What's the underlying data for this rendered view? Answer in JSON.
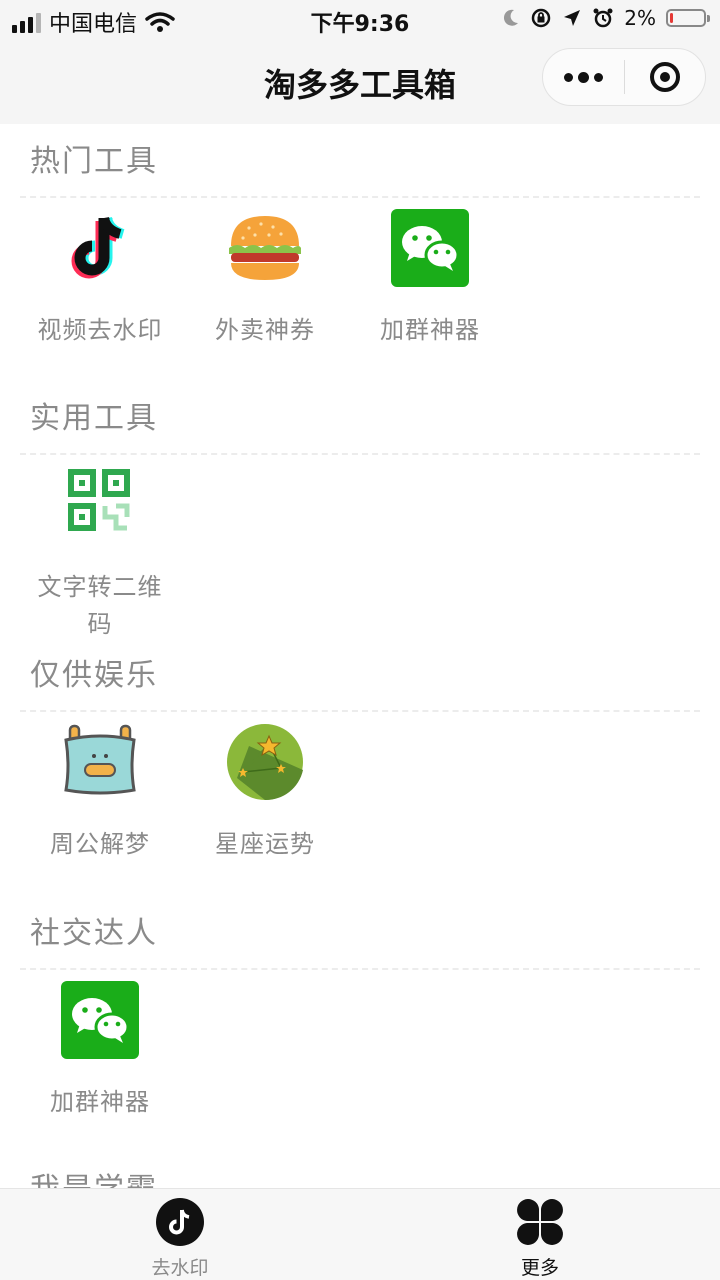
{
  "status_bar": {
    "carrier": "中国电信",
    "time": "下午9:36",
    "battery_percent": "2%",
    "battery_level": 0.02
  },
  "nav": {
    "title": "淘多多工具箱"
  },
  "sections": [
    {
      "title": "热门工具",
      "tools": [
        {
          "label": "视频去水印",
          "icon": "douyin-icon"
        },
        {
          "label": "外卖神券",
          "icon": "burger-icon"
        },
        {
          "label": "加群神器",
          "icon": "wechat-icon"
        }
      ]
    },
    {
      "title": "实用工具",
      "tools": [
        {
          "label": "文字转二维码",
          "icon": "qrcode-icon"
        }
      ]
    },
    {
      "title": "仅供娱乐",
      "tools": [
        {
          "label": "周公解梦",
          "icon": "pillow-icon"
        },
        {
          "label": "星座运势",
          "icon": "constellation-icon"
        }
      ]
    },
    {
      "title": "社交达人",
      "tools": [
        {
          "label": "加群神器",
          "icon": "wechat-icon"
        }
      ]
    },
    {
      "title": "我是学霸",
      "tools": []
    }
  ],
  "tabbar": {
    "tabs": [
      {
        "label": "去水印",
        "icon": "douyin-tab-icon",
        "active": false
      },
      {
        "label": "更多",
        "icon": "grid-flower-icon",
        "active": true
      }
    ]
  },
  "colors": {
    "wechat_green": "#1aad19",
    "qrcode_green": "#2fa84f",
    "section_gray": "#8a8a8a"
  }
}
